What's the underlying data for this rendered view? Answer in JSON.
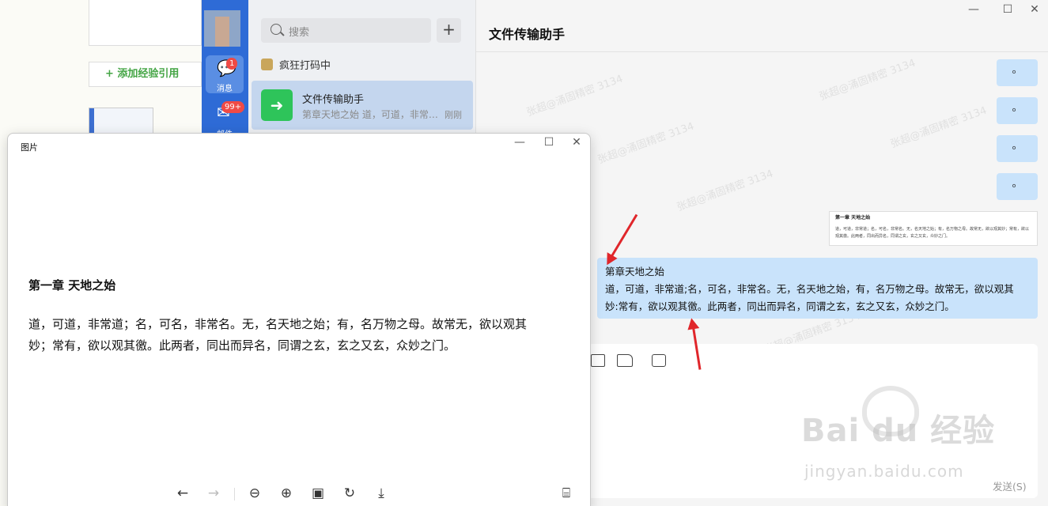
{
  "background_page": {
    "add_reference_label": "+ 添加经验引用"
  },
  "wechat": {
    "nav": {
      "messages_label": "消息",
      "messages_badge": "1",
      "mail_label": "邮件",
      "mail_badge": "99+"
    },
    "search_placeholder": "搜索",
    "plus_label": "+",
    "typing_status": "疯狂打码中",
    "chat_item": {
      "name": "文件传输助手",
      "preview": "第章天地之始 道，可道，非常…",
      "time": "刚刚"
    },
    "chat": {
      "title": "文件传输助手",
      "small_bubble_text": "。",
      "image_message": {
        "title": "第一章 天地之始",
        "body": "道，可道，非常道；名，可名，非常名。无，名天地之始；有，名万物之母。故常无，欲以观其妙；常有，欲以观其徼。此两者，同出而异名，同谓之玄，玄之又玄，众妙之门。"
      },
      "text_message": {
        "line1": "第章天地之始",
        "line2": "道，可道，非常道;名，可名，非常名。无，名天地之始，有，名万物之母。故常无，欲以观其",
        "line3": "妙:常有，欲以观其徼。此两者，同出而异名，同谓之玄，玄之又玄，众妙之门。"
      },
      "send_label": "发送(S)",
      "watermark": "张超@涌固精密 3134"
    },
    "window_controls": {
      "minimize": "—",
      "maximize": "☐",
      "close": "✕"
    }
  },
  "viewer": {
    "title": "图片",
    "heading": "第一章 天地之始",
    "body_line1": "道，可道，非常道；名，可名，非常名。无，名天地之始；有，名万物之母。故常无，欲以观其",
    "body_line2": "妙；常有，欲以观其徼。此两者，同出而异名，同谓之玄，玄之又玄，众妙之门。",
    "window_controls": {
      "minimize": "—",
      "maximize": "☐",
      "close": "✕"
    },
    "toolbar_icons": [
      "back-arrow-icon",
      "forward-arrow-icon",
      "zoom-out-icon",
      "zoom-in-icon",
      "fit-window-icon",
      "rotate-icon",
      "download-icon",
      "ocr-scan-icon"
    ]
  },
  "baidu_watermark": {
    "brand": "Bai du 经验",
    "url": "jingyan.baidu.com"
  },
  "colors": {
    "nav_blue": "#2e6bd6",
    "bubble_blue": "#c9e3fb",
    "arrow_red": "#e0262b",
    "selected_item": "#c4d6ee"
  }
}
